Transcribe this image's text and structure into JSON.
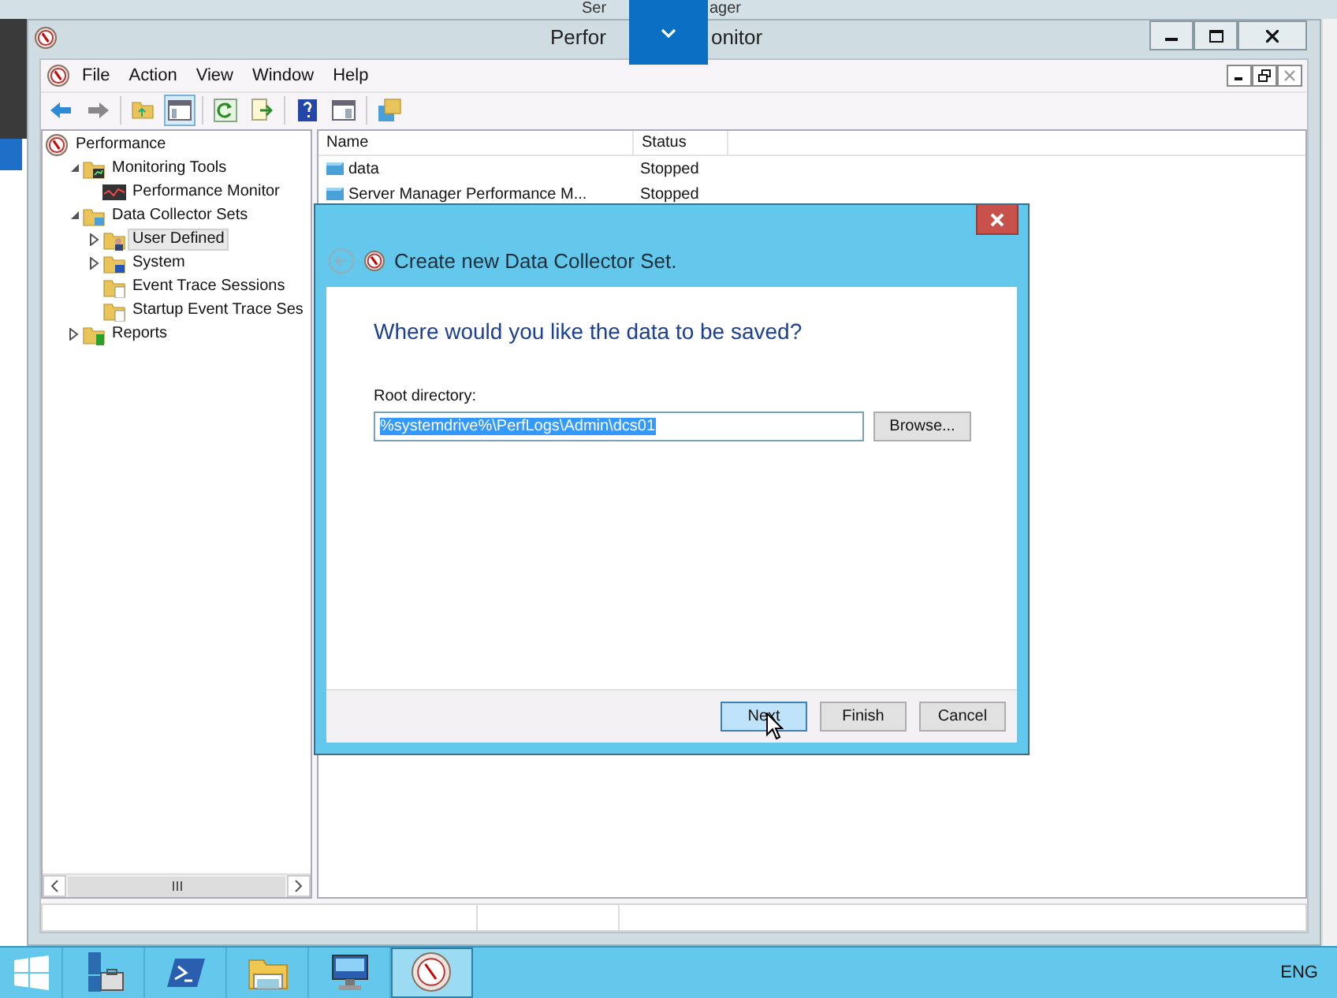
{
  "background_window": {
    "title_parts": [
      "Ser",
      "ager"
    ]
  },
  "window": {
    "title_parts": [
      "Perfor",
      "onitor"
    ]
  },
  "menu": [
    "File",
    "Action",
    "View",
    "Window",
    "Help"
  ],
  "tree": [
    {
      "label": "Performance",
      "kind": "gauge",
      "selected": false,
      "children": [
        {
          "label": "Monitoring Tools",
          "kind": "folder-chart",
          "expanded": true,
          "selected": false,
          "children": [
            {
              "label": "Performance Monitor",
              "kind": "chart",
              "selected": false
            }
          ]
        },
        {
          "label": "Data Collector Sets",
          "kind": "folder-set",
          "expanded": true,
          "selected": false,
          "children": [
            {
              "label": "User Defined",
              "kind": "folder-user",
              "expanded": false,
              "selected": true
            },
            {
              "label": "System",
              "kind": "folder-system",
              "expanded": false,
              "selected": false
            },
            {
              "label": "Event Trace Sessions",
              "kind": "folder-trace",
              "selected": false
            },
            {
              "label": "Startup Event Trace Ses",
              "kind": "folder-trace",
              "selected": false
            }
          ]
        },
        {
          "label": "Reports",
          "kind": "folder-report",
          "expanded": false,
          "selected": false
        }
      ]
    }
  ],
  "list": {
    "columns": [
      "Name",
      "Status"
    ],
    "rows": [
      {
        "name": "data",
        "status": "Stopped"
      },
      {
        "name": "Server Manager Performance M...",
        "status": "Stopped"
      }
    ]
  },
  "dialog": {
    "title": "Create new Data Collector Set.",
    "heading": "Where would you like the data to be saved?",
    "field_label": "Root directory:",
    "field_value": "%systemdrive%\\PerfLogs\\Admin\\dcs01",
    "value_selected": true,
    "browse_button": "Browse...",
    "buttons": [
      {
        "label": "Next",
        "hovered": true
      },
      {
        "label": "Finish",
        "hovered": false
      },
      {
        "label": "Cancel",
        "hovered": false
      }
    ]
  },
  "taskbar": {
    "apps": [
      {
        "kind": "servers",
        "selected": false
      },
      {
        "kind": "shell",
        "selected": false
      },
      {
        "kind": "folder",
        "selected": false
      },
      {
        "kind": "computer",
        "selected": false
      },
      {
        "kind": "gauge",
        "selected": true
      }
    ],
    "language": "ENG"
  }
}
